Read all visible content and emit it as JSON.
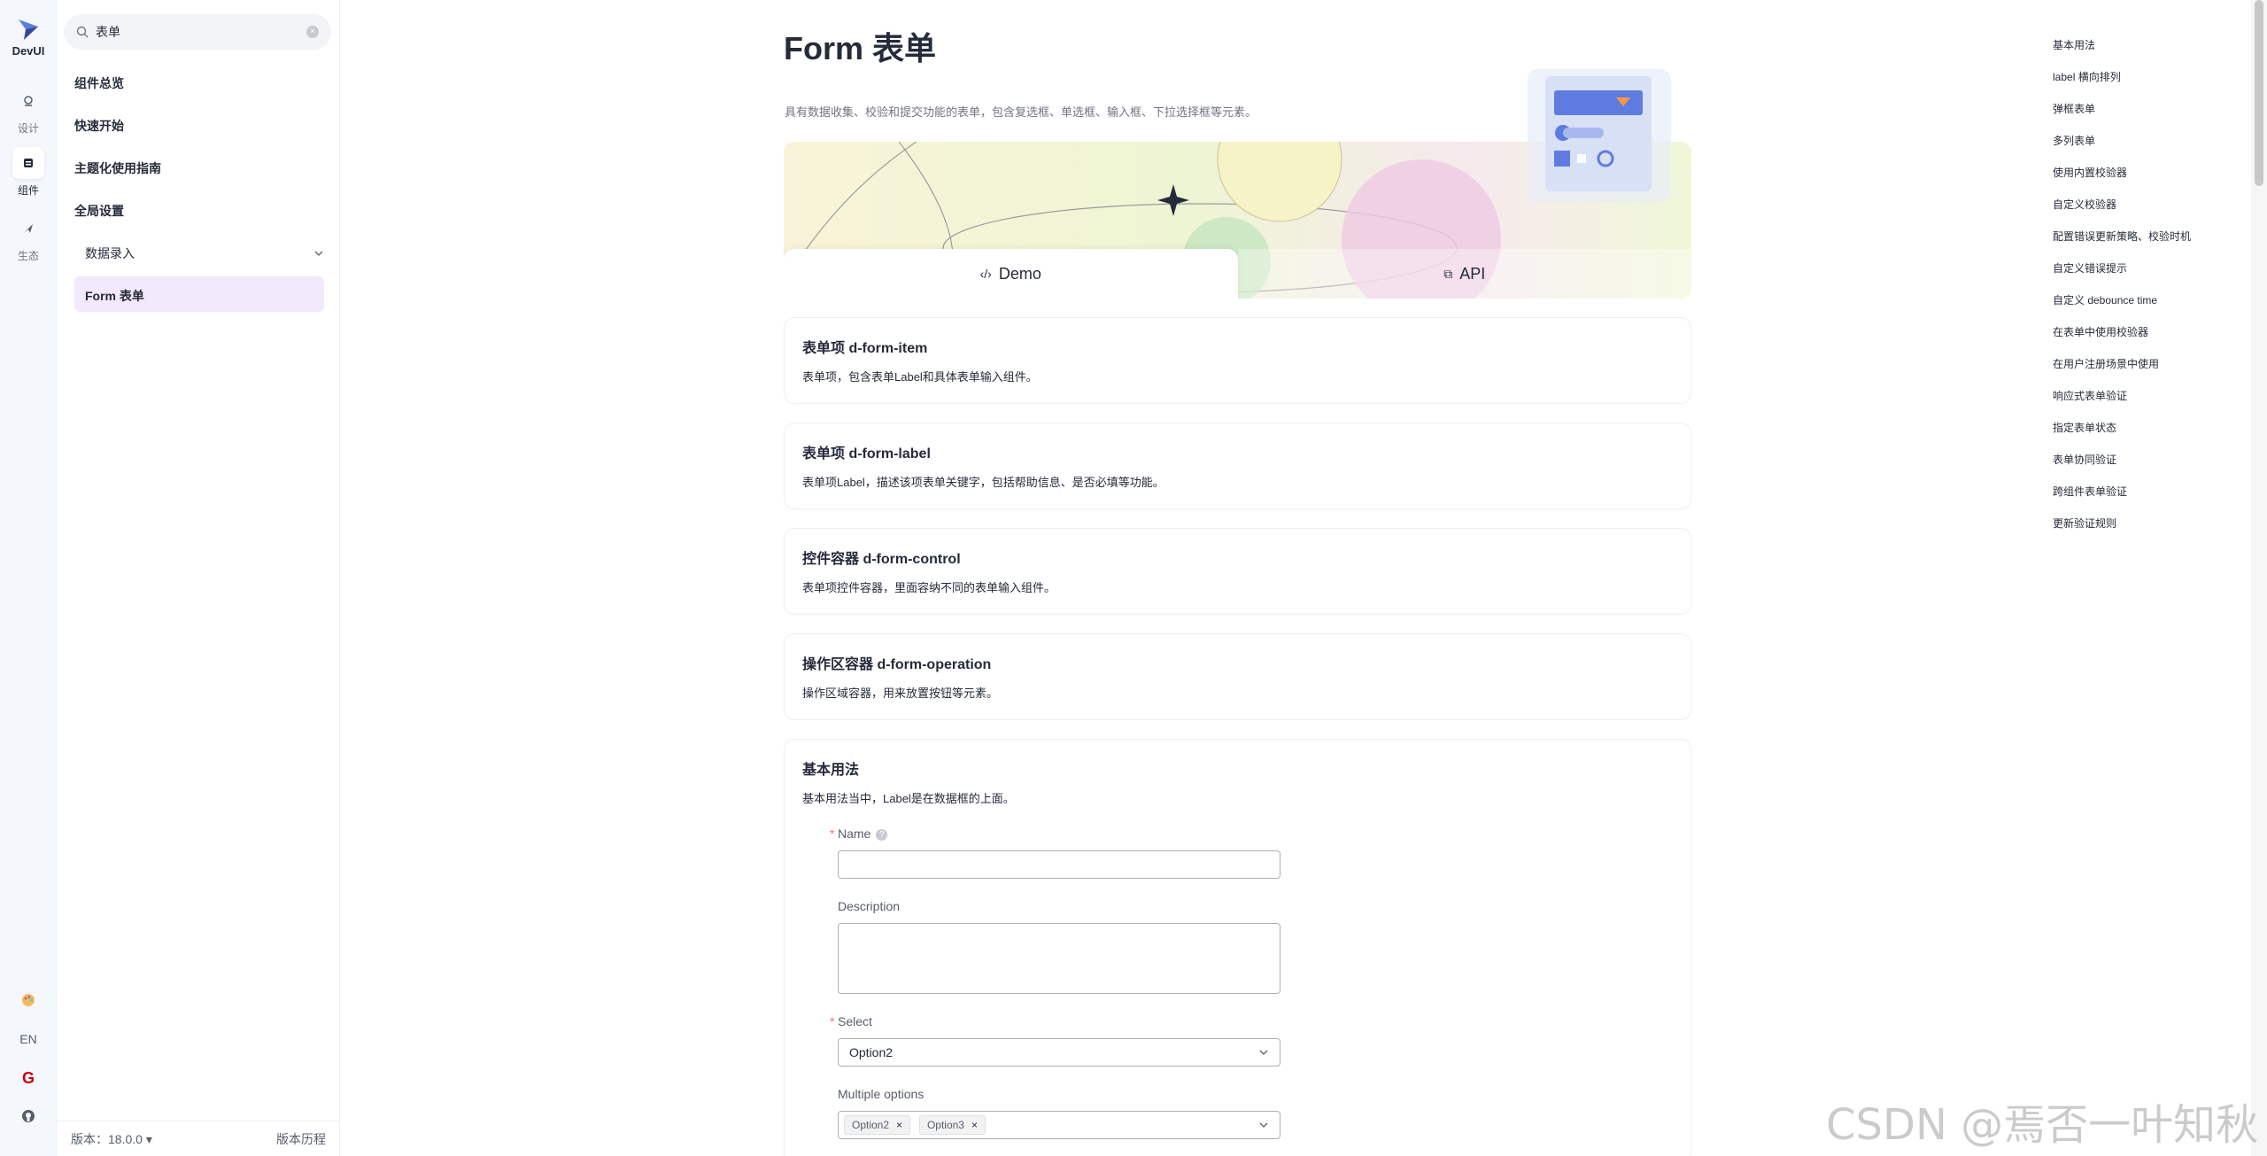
{
  "rail": {
    "logo_text": "DevUI",
    "items": [
      {
        "label": "设计",
        "icon": "design-icon"
      },
      {
        "label": "组件",
        "icon": "component-icon"
      },
      {
        "label": "生态",
        "icon": "ecosystem-icon"
      }
    ],
    "bottom": [
      {
        "label": "",
        "icon": "theme-palette-icon"
      },
      {
        "label": "EN",
        "icon": "language-icon"
      },
      {
        "label": "G",
        "icon": "gitee-icon"
      },
      {
        "label": "",
        "icon": "github-icon"
      }
    ]
  },
  "sidebar": {
    "search_value": "表单",
    "items": [
      "组件总览",
      "快速开始",
      "主题化使用指南",
      "全局设置"
    ],
    "group": "数据录入",
    "active_item": "Form 表单",
    "version": "版本：18.0.0",
    "history": "版本历程"
  },
  "page": {
    "title": "Form 表单",
    "subtitle": "具有数据收集、校验和提交功能的表单，包含复选框、单选框、输入框、下拉选择框等元素。",
    "tabs": [
      "Demo",
      "API"
    ]
  },
  "cards": [
    {
      "title": "表单项 d-form-item",
      "desc": "表单项，包含表单Label和具体表单输入组件。"
    },
    {
      "title": "表单项 d-form-label",
      "desc": "表单项Label，描述该项表单关键字，包括帮助信息、是否必填等功能。"
    },
    {
      "title": "控件容器 d-form-control",
      "desc": "表单项控件容器，里面容纳不同的表单输入组件。"
    },
    {
      "title": "操作区容器 d-form-operation",
      "desc": "操作区域容器，用来放置按钮等元素。"
    }
  ],
  "basic": {
    "title": "基本用法",
    "desc": "基本用法当中，Label是在数据框的上面。",
    "name_label": "Name",
    "description_label": "Description",
    "select_label": "Select",
    "select_value": "Option2",
    "multi_label": "Multiple options",
    "multi_tags": [
      "Option2",
      "Option3"
    ]
  },
  "anchors": [
    "基本用法",
    "label 横向排列",
    "弹框表单",
    "多列表单",
    "使用内置校验器",
    "自定义校验器",
    "配置错误更新策略、校验时机",
    "自定义错误提示",
    "自定义 debounce time",
    "在表单中使用校验器",
    "在用户注册场景中使用",
    "响应式表单验证",
    "指定表单状态",
    "表单协同验证",
    "跨组件表单验证",
    "更新验证规则"
  ],
  "watermark": "CSDN @焉否一叶知秋",
  "colors": {
    "accent": "#5e7ce0",
    "active_bg": "#f2e9fb",
    "required": "#f66f6a"
  }
}
